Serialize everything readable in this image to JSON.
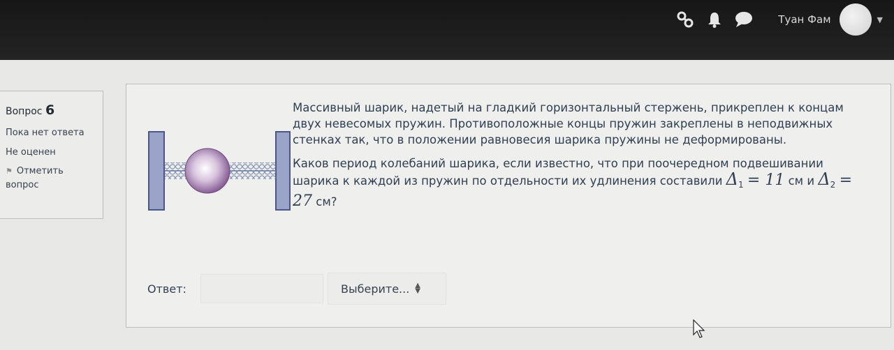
{
  "navbar": {
    "icons": [
      "connections-icon",
      "bell-icon",
      "chat-icon"
    ],
    "user_name": "Туан Фам"
  },
  "question_info": {
    "label": "Вопрос",
    "number": "6",
    "state": "Пока нет ответа",
    "grade": "Не оценен",
    "flag_label": "Отметить вопрос"
  },
  "question": {
    "paragraph1": "Массивный шарик, надетый на гладкий горизонтальный стержень, прикреплен к концам двух невесомых пружин. Противоположные концы пружин закреплены в неподвижных стенках так, что в положении равновесия шарика пружины не деформированы.",
    "paragraph2_text": "Каков период колебаний шарика, если известно, что при поочередном подвешивании шарика к каждой из пружин по отдельности их удлинения составили",
    "delta_symbol": "Δ",
    "delta1_sub": "1",
    "delta1_value": "= 11",
    "unit1": "см и",
    "delta2_sub": "2",
    "delta2_value": "= 27",
    "unit2": "см?"
  },
  "answer": {
    "label": "Ответ:",
    "input_value": "",
    "select_value": "Выберите..."
  },
  "colors": {
    "navbar_bg": "#1c1c1c",
    "page_bg": "#e8e8e6",
    "text": "#2f3f52",
    "wall_fill": "#9aa4c8",
    "ball": "#8a5a9a"
  }
}
